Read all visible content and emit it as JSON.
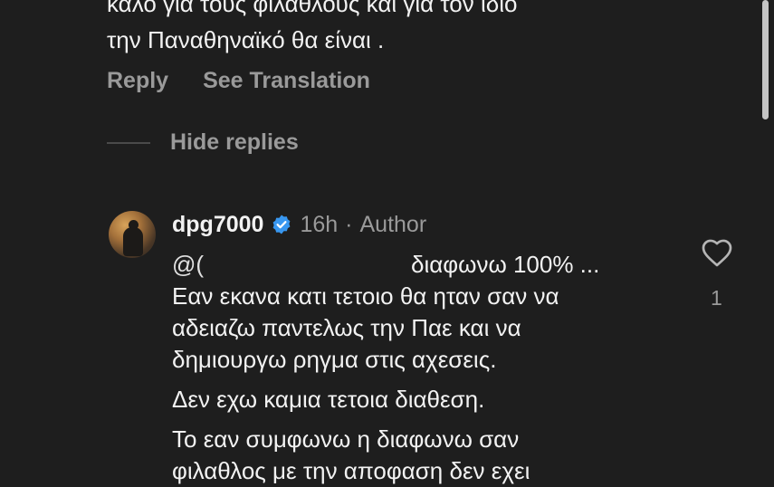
{
  "parent_comment": {
    "lines": [
      "καλο για τους φιλαθλους και για τον ιδιο",
      "την Παναθηναϊκό θα είναι ."
    ],
    "actions": {
      "reply": "Reply",
      "see_translation": "See Translation"
    }
  },
  "replies_toggle": {
    "label": "Hide replies"
  },
  "reply": {
    "username": "dpg7000",
    "verified": true,
    "time": "16h",
    "separator": "·",
    "badge": "Author",
    "mention": "@(",
    "first_line_text": "διαφωνω 100% ...",
    "paragraphs": [
      [
        "Εαν εκανα κατι τετοιο θα ηταν σαν να",
        "αδειαζω παντελως την Παε και να",
        "δημιουργω ρηγμα στις αχεσεις."
      ],
      [
        "Δεν εχω καμια τετοια διαθεση."
      ],
      [
        "Το εαν συμφωνω η διαφωνω σαν",
        "φιλαθλος με την αποφαση δεν εχει"
      ]
    ],
    "likes": "1"
  },
  "colors": {
    "background": "#1e1e1e",
    "text": "#f2f2f2",
    "secondary": "#9a9a9a",
    "verified": "#3897f0"
  }
}
